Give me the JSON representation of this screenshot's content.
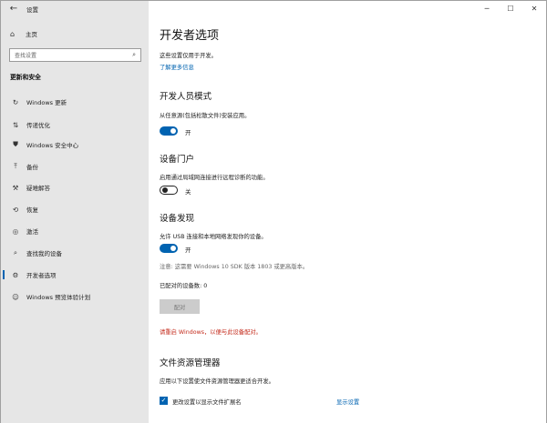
{
  "window": {
    "title": "设置",
    "back_glyph": "←",
    "controls": {
      "minimize": "─",
      "maximize": "☐",
      "close": "✕"
    }
  },
  "sidebar": {
    "home_label": "主页",
    "search_placeholder": "查找设置",
    "section_title": "更新和安全",
    "items": [
      {
        "label": "Windows 更新",
        "icon": "sync-icon",
        "glyph": "↻"
      },
      {
        "label": "传递优化",
        "icon": "delivery-optimization-icon",
        "glyph": "⇅"
      },
      {
        "label": "Windows 安全中心",
        "icon": "shield-icon",
        "glyph": "⛊"
      },
      {
        "label": "备份",
        "icon": "backup-icon",
        "glyph": "⤒"
      },
      {
        "label": "疑难解答",
        "icon": "wrench-icon",
        "glyph": "⚒"
      },
      {
        "label": "恢复",
        "icon": "recovery-icon",
        "glyph": "⟲"
      },
      {
        "label": "激活",
        "icon": "activation-icon",
        "glyph": "◎"
      },
      {
        "label": "查找我的设备",
        "icon": "find-device-icon",
        "glyph": "⌕"
      },
      {
        "label": "开发者选项",
        "icon": "developer-icon",
        "glyph": "⚙",
        "selected": true
      },
      {
        "label": "Windows 预览体验计划",
        "icon": "insider-icon",
        "glyph": "☺"
      }
    ]
  },
  "main": {
    "title": "开发者选项",
    "intro": "这些设置仅用于开发。",
    "learn_more": "了解更多信息",
    "dev_mode": {
      "heading": "开发人员模式",
      "description": "从任意源(包括松散文件)安装应用。",
      "toggle_state": "开"
    },
    "device_portal": {
      "heading": "设备门户",
      "description": "启用通过局域网连接进行远程诊断的功能。",
      "toggle_state": "关"
    },
    "device_discovery": {
      "heading": "设备发现",
      "description": "允许 USB 连接和本地网络发现你的设备。",
      "toggle_state": "开",
      "note": "注意: 这需要 Windows 10 SDK 版本 1803 或更高版本。",
      "paired_count": "已配对的设备数: 0",
      "pair_button": "配对",
      "warning": "请重启 Windows，以便与此设备配对。"
    },
    "file_explorer": {
      "heading": "文件资源管理器",
      "description": "应用以下设置使文件资源管理器更适合开发。",
      "checkbox_label": "更改设置以显示文件扩展名",
      "checkbox_glyph": "✓",
      "show_settings": "显示设置"
    }
  }
}
